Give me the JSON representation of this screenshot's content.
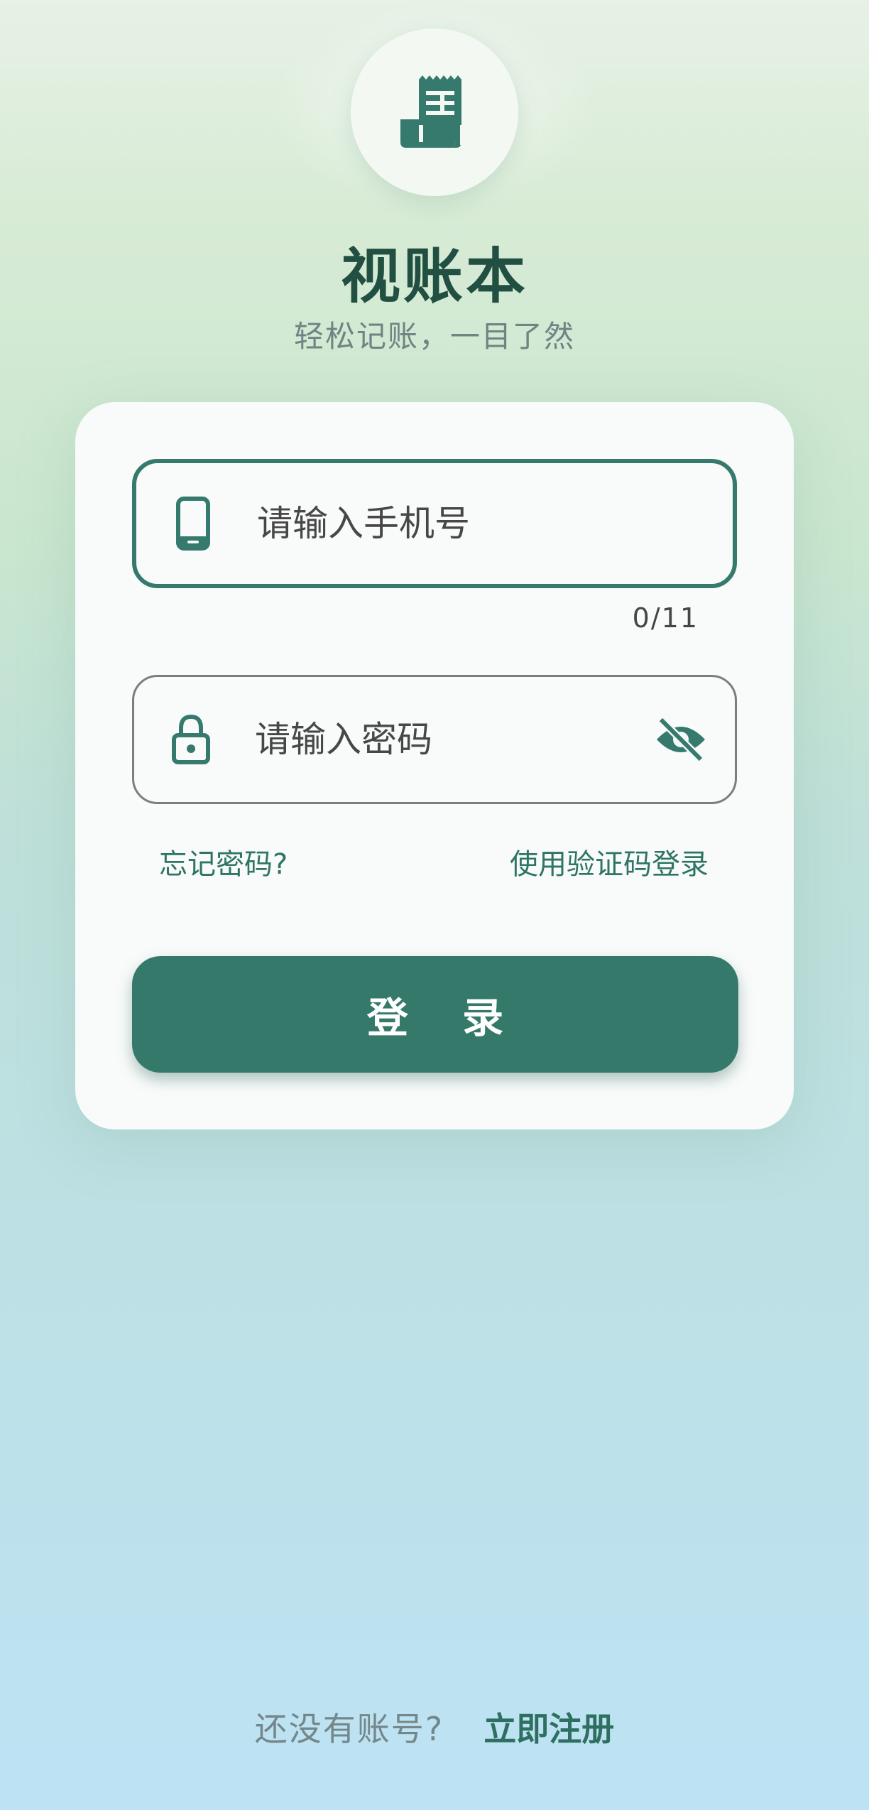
{
  "app": {
    "title": "视账本",
    "subtitle": "轻松记账，一目了然",
    "logo_icon": "receipt-icon"
  },
  "form": {
    "phone": {
      "icon": "phone-icon",
      "placeholder": "请输入手机号",
      "value": "",
      "counter": "0/11"
    },
    "password": {
      "icon": "lock-icon",
      "placeholder": "请输入密码",
      "value": "",
      "toggle_icon": "eye-off-icon"
    },
    "forgot_label": "忘记密码?",
    "sms_login_label": "使用验证码登录",
    "login_label": "登 录"
  },
  "footer": {
    "question": "还没有账号?",
    "register_label": "立即注册"
  },
  "colors": {
    "primary": "#35796b",
    "title": "#214f42",
    "subtitle": "#6f8483",
    "link": "#2f7565"
  }
}
